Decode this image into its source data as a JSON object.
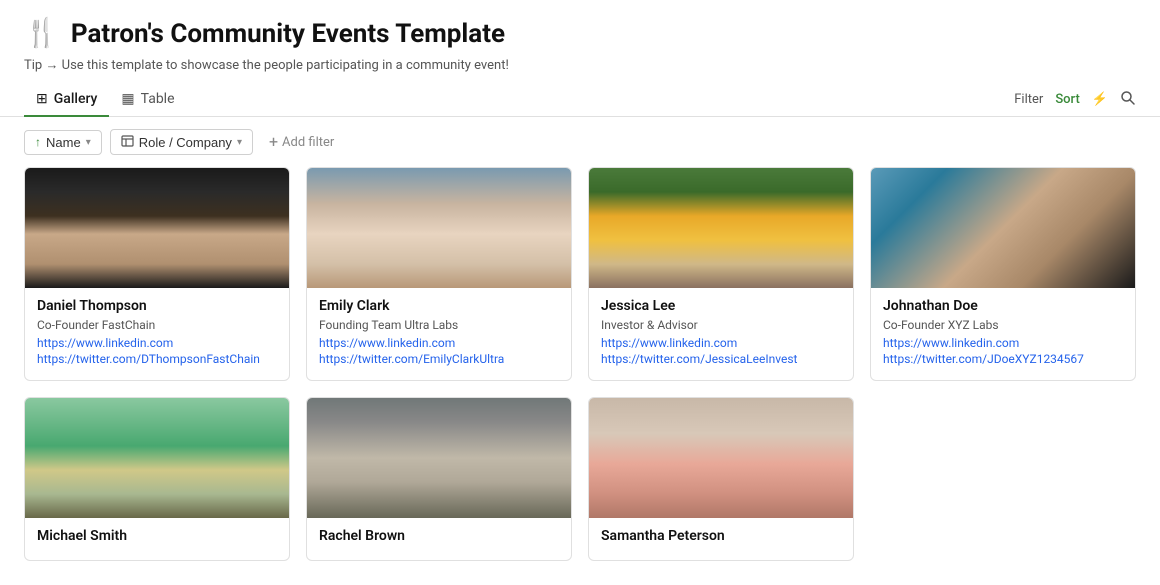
{
  "app": {
    "icon": "🍴",
    "title": "Patron's Community Events Template",
    "tip": "Tip → Use this template to showcase the people participating in a community event!"
  },
  "tabs": [
    {
      "id": "gallery",
      "label": "Gallery",
      "icon": "grid",
      "active": true
    },
    {
      "id": "table",
      "label": "Table",
      "icon": "table",
      "active": false
    }
  ],
  "top_controls": {
    "filter_label": "Filter",
    "sort_label": "Sort"
  },
  "filters": [
    {
      "id": "name",
      "label": "Name",
      "icon": "sort-asc",
      "has_arrow": true
    },
    {
      "id": "role_company",
      "label": "Role / Company",
      "icon": "building",
      "has_arrow": true
    },
    {
      "id": "add_filter",
      "label": "Add filter"
    }
  ],
  "people": [
    {
      "id": "daniel-thompson",
      "name": "Daniel Thompson",
      "role": "Co-Founder FastChain",
      "linkedin": "https://www.linkedin.com",
      "twitter": "https://twitter.com/DThompsonFastChain",
      "photo_class": "photo-1",
      "row": 1
    },
    {
      "id": "emily-clark",
      "name": "Emily Clark",
      "role": "Founding Team Ultra Labs",
      "linkedin": "https://www.linkedin.com",
      "twitter": "https://twitter.com/EmilyClarkUltra",
      "photo_class": "photo-2",
      "row": 1
    },
    {
      "id": "jessica-lee",
      "name": "Jessica Lee",
      "role": "Investor & Advisor",
      "linkedin": "https://www.linkedin.com",
      "twitter": "https://twitter.com/JessicaLeeInvest",
      "photo_class": "photo-3",
      "row": 1
    },
    {
      "id": "johnathan-doe",
      "name": "Johnathan Doe",
      "role": "Co-Founder XYZ Labs",
      "linkedin": "https://www.linkedin.com",
      "twitter": "https://twitter.com/JDoeXYZ1234567",
      "photo_class": "photo-4",
      "row": 1
    },
    {
      "id": "michael-smith",
      "name": "Michael Smith",
      "role": "",
      "linkedin": "",
      "twitter": "",
      "photo_class": "photo-5",
      "row": 2
    },
    {
      "id": "rachel-brown",
      "name": "Rachel Brown",
      "role": "",
      "linkedin": "",
      "twitter": "",
      "photo_class": "photo-6",
      "row": 2
    },
    {
      "id": "samantha-peterson",
      "name": "Samantha Peterson",
      "role": "",
      "linkedin": "",
      "twitter": "",
      "photo_class": "photo-7",
      "row": 2
    }
  ]
}
